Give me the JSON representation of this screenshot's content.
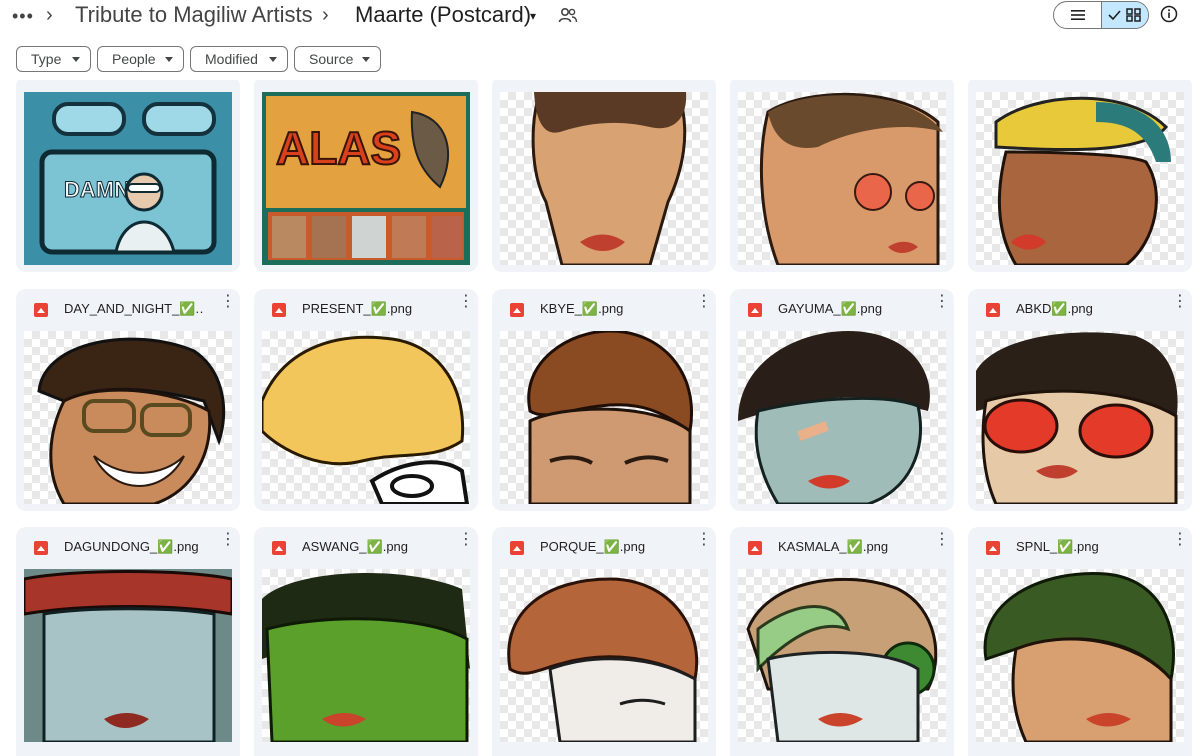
{
  "header": {
    "more_label": "•••",
    "breadcrumb": [
      {
        "label": "Tribute to Magiliw Artists"
      },
      {
        "label": "Maarte (Postcard)"
      }
    ],
    "separator": "›",
    "caret": "▾",
    "shared_icon": "people-icon",
    "view_options": [
      "list-icon",
      "grid-icon"
    ],
    "info_icon": "info-icon"
  },
  "filters": [
    {
      "label": "Type"
    },
    {
      "label": "People"
    },
    {
      "label": "Modified"
    },
    {
      "label": "Source"
    }
  ],
  "row1": [
    {
      "thumb": "poster-alas-da-great-1"
    },
    {
      "thumb": "poster-alas-da-great-2"
    },
    {
      "thumb": "portrait"
    },
    {
      "thumb": "portrait-red-glasses"
    },
    {
      "thumb": "portrait-yellow-cap"
    }
  ],
  "row2": [
    {
      "name": "DAY_AND_NIGHT_✅.…"
    },
    {
      "name": "PRESENT_✅.png"
    },
    {
      "name": "KBYE_✅.png"
    },
    {
      "name": "GAYUMA_✅.png"
    },
    {
      "name": "ABKD✅.png"
    }
  ],
  "row3": [
    {
      "name": "DAGUNDONG_✅.png"
    },
    {
      "name": "ASWANG_✅.png"
    },
    {
      "name": "PORQUE_✅.png"
    },
    {
      "name": "KASMALA_✅.png"
    },
    {
      "name": "SPNL_✅.png"
    }
  ],
  "colors": {
    "card_bg": "#f0f4f9",
    "toggle_active": "#c2e7ff",
    "file_icon": "#ea4335"
  }
}
